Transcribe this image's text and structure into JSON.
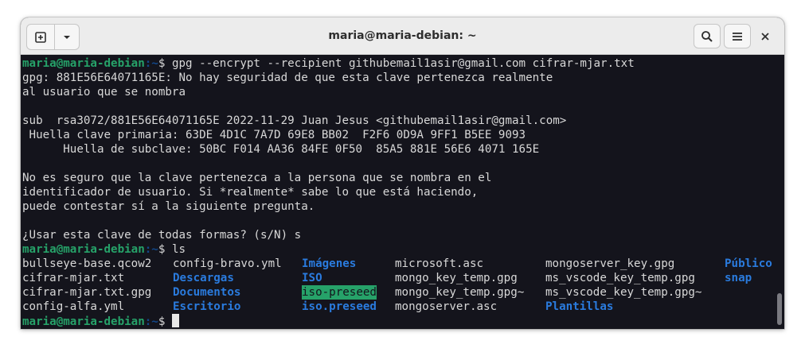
{
  "window": {
    "title": "maria@maria-debian: ~"
  },
  "prompt": {
    "user": "maria@maria-debian",
    "path": ":~",
    "symbol": "$ "
  },
  "terminal": {
    "cmd1": "gpg --encrypt --recipient githubemail1asir@gmail.com cifrar-mjar.txt",
    "out1": "gpg: 881E56E64071165E: No hay seguridad de que esta clave pertenezca realmente",
    "out2": "al usuario que se nombra",
    "out3": "",
    "out4": "sub  rsa3072/881E56E64071165E 2022-11-29 Juan Jesus <githubemail1asir@gmail.com>",
    "out5": " Huella clave primaria: 63DE 4D1C 7A7D 69E8 BB02  F2F6 0D9A 9FF1 B5EE 9093",
    "out6": "      Huella de subclave: 50BC F014 AA36 84FE 0F50  85A5 881E 56E6 4071 165E",
    "out7": "",
    "out8": "No es seguro que la clave pertenezca a la persona que se nombra en el",
    "out9": "identificador de usuario. Si *realmente* sabe lo que está haciendo,",
    "out10": "puede contestar sí a la siguiente pregunta.",
    "out11": "",
    "out12": "¿Usar esta clave de todas formas? (s/N) s",
    "cmd2": "ls"
  },
  "ls": [
    [
      "bullseye-base.qcow2",
      "config-bravo.yml",
      "Imágenes",
      "microsoft.asc",
      "mongoserver_key.gpg",
      "Público"
    ],
    [
      "cifrar-mjar.txt",
      "Descargas",
      "ISO",
      "mongo_key_temp.gpg",
      "ms_vscode_key_temp.gpg",
      "snap"
    ],
    [
      "cifrar-mjar.txt.gpg",
      "Documentos",
      "iso-preseed",
      "mongo_key_temp.gpg~",
      "ms_vscode_key_temp.gpg~",
      ""
    ],
    [
      "config-alfa.yml",
      "Escritorio",
      "iso.preseed",
      "mongoserver.asc",
      "Plantillas",
      ""
    ]
  ],
  "colors": {
    "prompt_user": "#26a269",
    "prompt_path": "#12488b",
    "directory": "#2a7bde",
    "background": "#14141c"
  },
  "icons": [
    "new-tab-icon",
    "chevron-down-icon",
    "search-icon",
    "hamburger-menu-icon",
    "close-icon"
  ]
}
